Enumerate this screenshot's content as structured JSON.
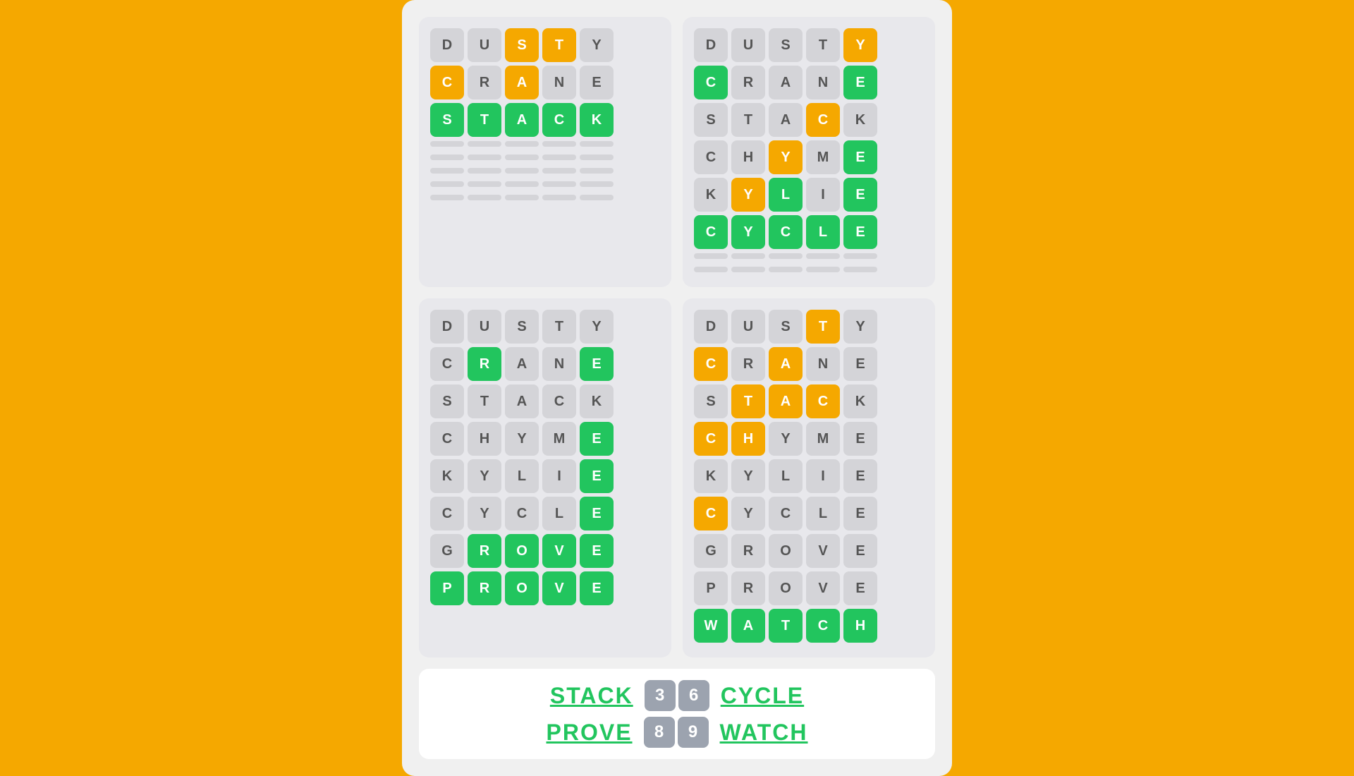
{
  "background_color": "#F5A800",
  "grids": [
    {
      "id": "top-left",
      "rows": [
        [
          {
            "letter": "D",
            "state": "white"
          },
          {
            "letter": "U",
            "state": "white"
          },
          {
            "letter": "S",
            "state": "yellow"
          },
          {
            "letter": "T",
            "state": "yellow"
          },
          {
            "letter": "Y",
            "state": "white"
          }
        ],
        [
          {
            "letter": "C",
            "state": "yellow"
          },
          {
            "letter": "R",
            "state": "white"
          },
          {
            "letter": "A",
            "state": "yellow"
          },
          {
            "letter": "N",
            "state": "white"
          },
          {
            "letter": "E",
            "state": "white"
          }
        ],
        [
          {
            "letter": "S",
            "state": "green"
          },
          {
            "letter": "T",
            "state": "green"
          },
          {
            "letter": "A",
            "state": "green"
          },
          {
            "letter": "C",
            "state": "green"
          },
          {
            "letter": "K",
            "state": "green"
          }
        ]
      ],
      "empty_rows": 5
    },
    {
      "id": "top-right",
      "rows": [
        [
          {
            "letter": "D",
            "state": "white"
          },
          {
            "letter": "U",
            "state": "white"
          },
          {
            "letter": "S",
            "state": "white"
          },
          {
            "letter": "T",
            "state": "white"
          },
          {
            "letter": "Y",
            "state": "yellow"
          }
        ],
        [
          {
            "letter": "C",
            "state": "green"
          },
          {
            "letter": "R",
            "state": "white"
          },
          {
            "letter": "A",
            "state": "white"
          },
          {
            "letter": "N",
            "state": "white"
          },
          {
            "letter": "E",
            "state": "green"
          }
        ],
        [
          {
            "letter": "S",
            "state": "white"
          },
          {
            "letter": "T",
            "state": "white"
          },
          {
            "letter": "A",
            "state": "white"
          },
          {
            "letter": "C",
            "state": "yellow"
          },
          {
            "letter": "K",
            "state": "white"
          }
        ],
        [
          {
            "letter": "C",
            "state": "white"
          },
          {
            "letter": "H",
            "state": "white"
          },
          {
            "letter": "Y",
            "state": "yellow"
          },
          {
            "letter": "M",
            "state": "white"
          },
          {
            "letter": "E",
            "state": "green"
          }
        ],
        [
          {
            "letter": "K",
            "state": "white"
          },
          {
            "letter": "Y",
            "state": "yellow"
          },
          {
            "letter": "L",
            "state": "green"
          },
          {
            "letter": "I",
            "state": "white"
          },
          {
            "letter": "E",
            "state": "green"
          }
        ],
        [
          {
            "letter": "C",
            "state": "green"
          },
          {
            "letter": "Y",
            "state": "green"
          },
          {
            "letter": "C",
            "state": "green"
          },
          {
            "letter": "L",
            "state": "green"
          },
          {
            "letter": "E",
            "state": "green"
          }
        ]
      ],
      "empty_rows": 2
    },
    {
      "id": "bottom-left",
      "rows": [
        [
          {
            "letter": "D",
            "state": "white"
          },
          {
            "letter": "U",
            "state": "white"
          },
          {
            "letter": "S",
            "state": "white"
          },
          {
            "letter": "T",
            "state": "white"
          },
          {
            "letter": "Y",
            "state": "white"
          }
        ],
        [
          {
            "letter": "C",
            "state": "white"
          },
          {
            "letter": "R",
            "state": "green"
          },
          {
            "letter": "A",
            "state": "white"
          },
          {
            "letter": "N",
            "state": "white"
          },
          {
            "letter": "E",
            "state": "green"
          }
        ],
        [
          {
            "letter": "S",
            "state": "white"
          },
          {
            "letter": "T",
            "state": "white"
          },
          {
            "letter": "A",
            "state": "white"
          },
          {
            "letter": "C",
            "state": "white"
          },
          {
            "letter": "K",
            "state": "white"
          }
        ],
        [
          {
            "letter": "C",
            "state": "white"
          },
          {
            "letter": "H",
            "state": "white"
          },
          {
            "letter": "Y",
            "state": "white"
          },
          {
            "letter": "M",
            "state": "white"
          },
          {
            "letter": "E",
            "state": "green"
          }
        ],
        [
          {
            "letter": "K",
            "state": "white"
          },
          {
            "letter": "Y",
            "state": "white"
          },
          {
            "letter": "L",
            "state": "white"
          },
          {
            "letter": "I",
            "state": "white"
          },
          {
            "letter": "E",
            "state": "green"
          }
        ],
        [
          {
            "letter": "C",
            "state": "white"
          },
          {
            "letter": "Y",
            "state": "white"
          },
          {
            "letter": "C",
            "state": "white"
          },
          {
            "letter": "L",
            "state": "white"
          },
          {
            "letter": "E",
            "state": "green"
          }
        ],
        [
          {
            "letter": "G",
            "state": "white"
          },
          {
            "letter": "R",
            "state": "green"
          },
          {
            "letter": "O",
            "state": "green"
          },
          {
            "letter": "V",
            "state": "green"
          },
          {
            "letter": "E",
            "state": "green"
          }
        ],
        [
          {
            "letter": "P",
            "state": "green"
          },
          {
            "letter": "R",
            "state": "green"
          },
          {
            "letter": "O",
            "state": "green"
          },
          {
            "letter": "V",
            "state": "green"
          },
          {
            "letter": "E",
            "state": "green"
          }
        ]
      ],
      "empty_rows": 0
    },
    {
      "id": "bottom-right",
      "rows": [
        [
          {
            "letter": "D",
            "state": "white"
          },
          {
            "letter": "U",
            "state": "white"
          },
          {
            "letter": "S",
            "state": "white"
          },
          {
            "letter": "T",
            "state": "yellow"
          },
          {
            "letter": "Y",
            "state": "white"
          }
        ],
        [
          {
            "letter": "C",
            "state": "yellow"
          },
          {
            "letter": "R",
            "state": "white"
          },
          {
            "letter": "A",
            "state": "yellow"
          },
          {
            "letter": "N",
            "state": "white"
          },
          {
            "letter": "E",
            "state": "white"
          }
        ],
        [
          {
            "letter": "S",
            "state": "white"
          },
          {
            "letter": "T",
            "state": "yellow"
          },
          {
            "letter": "A",
            "state": "yellow"
          },
          {
            "letter": "C",
            "state": "yellow"
          },
          {
            "letter": "K",
            "state": "white"
          }
        ],
        [
          {
            "letter": "C",
            "state": "yellow"
          },
          {
            "letter": "H",
            "state": "yellow"
          },
          {
            "letter": "Y",
            "state": "white"
          },
          {
            "letter": "M",
            "state": "white"
          },
          {
            "letter": "E",
            "state": "white"
          }
        ],
        [
          {
            "letter": "K",
            "state": "white"
          },
          {
            "letter": "Y",
            "state": "white"
          },
          {
            "letter": "L",
            "state": "white"
          },
          {
            "letter": "I",
            "state": "white"
          },
          {
            "letter": "E",
            "state": "white"
          }
        ],
        [
          {
            "letter": "C",
            "state": "yellow"
          },
          {
            "letter": "Y",
            "state": "white"
          },
          {
            "letter": "C",
            "state": "white"
          },
          {
            "letter": "L",
            "state": "white"
          },
          {
            "letter": "E",
            "state": "white"
          }
        ],
        [
          {
            "letter": "G",
            "state": "white"
          },
          {
            "letter": "R",
            "state": "white"
          },
          {
            "letter": "O",
            "state": "white"
          },
          {
            "letter": "V",
            "state": "white"
          },
          {
            "letter": "E",
            "state": "white"
          }
        ],
        [
          {
            "letter": "P",
            "state": "white"
          },
          {
            "letter": "R",
            "state": "white"
          },
          {
            "letter": "O",
            "state": "white"
          },
          {
            "letter": "V",
            "state": "white"
          },
          {
            "letter": "E",
            "state": "white"
          }
        ],
        [
          {
            "letter": "W",
            "state": "green"
          },
          {
            "letter": "A",
            "state": "green"
          },
          {
            "letter": "T",
            "state": "green"
          },
          {
            "letter": "C",
            "state": "green"
          },
          {
            "letter": "H",
            "state": "green"
          }
        ]
      ],
      "empty_rows": 0
    }
  ],
  "bottom": {
    "row1": {
      "word_left": "STACK",
      "scores": [
        "3",
        "6"
      ],
      "word_right": "CYCLE"
    },
    "row2": {
      "word_left": "PROVE",
      "scores": [
        "8",
        "9"
      ],
      "word_right": "WATCH"
    }
  }
}
